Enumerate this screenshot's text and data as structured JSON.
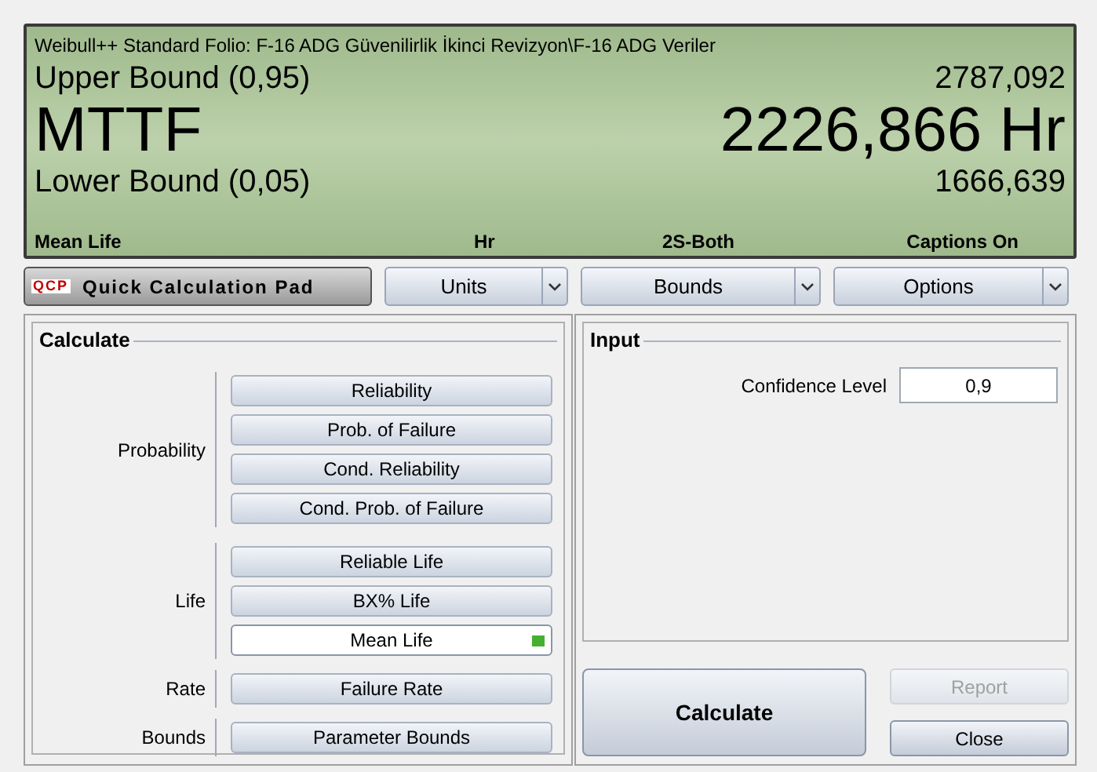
{
  "display": {
    "path": "Weibull++ Standard Folio: F-16 ADG Güvenilirlik İkinci Revizyon\\F-16 ADG Veriler",
    "upper_label": "Upper Bound (0,95)",
    "upper_value": "2787,092",
    "main_label": "MTTF",
    "main_value": "2226,866 Hr",
    "lower_label": "Lower Bound (0,05)",
    "lower_value": "1666,639",
    "status": [
      "Mean Life",
      "Hr",
      "2S-Both",
      "Captions On"
    ]
  },
  "toolbar": {
    "pad_label": "Quick Calculation Pad",
    "pad_icon_text": "QCP",
    "dropdowns": [
      "Units",
      "Bounds",
      "Options"
    ]
  },
  "calculate": {
    "title": "Calculate",
    "groups": [
      {
        "label": "Probability",
        "buttons": [
          {
            "label": "Reliability",
            "selected": false
          },
          {
            "label": "Prob. of Failure",
            "selected": false
          },
          {
            "label": "Cond. Reliability",
            "selected": false
          },
          {
            "label": "Cond. Prob. of Failure",
            "selected": false
          }
        ]
      },
      {
        "label": "Life",
        "buttons": [
          {
            "label": "Reliable Life",
            "selected": false
          },
          {
            "label": "BX% Life",
            "selected": false
          },
          {
            "label": "Mean Life",
            "selected": true
          }
        ]
      },
      {
        "label": "Rate",
        "buttons": [
          {
            "label": "Failure Rate",
            "selected": false
          }
        ]
      },
      {
        "label": "Bounds",
        "buttons": [
          {
            "label": "Parameter Bounds",
            "selected": false
          }
        ]
      }
    ]
  },
  "input": {
    "title": "Input",
    "fields": [
      {
        "label": "Confidence Level",
        "value": "0,9"
      }
    ]
  },
  "actions": [
    {
      "label": "Calculate",
      "kind": "primary",
      "disabled": false
    },
    {
      "label": "Report",
      "kind": "small",
      "disabled": true
    },
    {
      "label": "Close",
      "kind": "small",
      "disabled": false
    }
  ]
}
